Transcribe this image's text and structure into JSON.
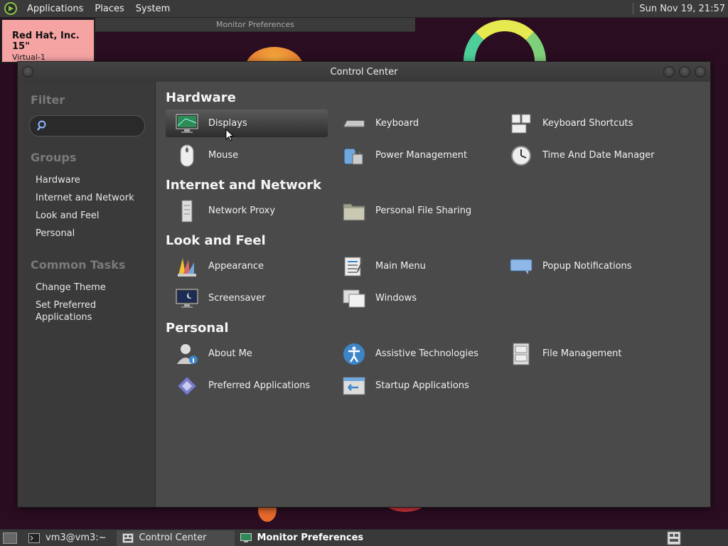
{
  "top_panel": {
    "menus": [
      "Applications",
      "Places",
      "System"
    ],
    "clock": "Sun Nov 19, 21:57"
  },
  "monitor_window": {
    "title": "Monitor Preferences"
  },
  "monitor_label": {
    "name": "Red Hat, Inc. 15\"",
    "output": "Virtual-1"
  },
  "control_center": {
    "title": "Control Center",
    "sidebar": {
      "filter_heading": "Filter",
      "filter_placeholder": "",
      "groups_heading": "Groups",
      "groups": [
        "Hardware",
        "Internet and Network",
        "Look and Feel",
        "Personal"
      ],
      "tasks_heading": "Common Tasks",
      "tasks": [
        "Change Theme",
        "Set Preferred\nApplications"
      ]
    },
    "sections": [
      {
        "title": "Hardware",
        "items": [
          {
            "label": "Displays",
            "icon": "display-icon"
          },
          {
            "label": "Keyboard",
            "icon": "keyboard-icon"
          },
          {
            "label": "Keyboard Shortcuts",
            "icon": "keyboard-shortcuts-icon"
          },
          {
            "label": "Mouse",
            "icon": "mouse-icon"
          },
          {
            "label": "Power Management",
            "icon": "power-icon"
          },
          {
            "label": "Time And Date Manager",
            "icon": "clock-icon"
          }
        ]
      },
      {
        "title": "Internet and Network",
        "items": [
          {
            "label": "Network Proxy",
            "icon": "network-proxy-icon"
          },
          {
            "label": "Personal File Sharing",
            "icon": "folder-share-icon"
          }
        ]
      },
      {
        "title": "Look and Feel",
        "items": [
          {
            "label": "Appearance",
            "icon": "appearance-icon"
          },
          {
            "label": "Main Menu",
            "icon": "main-menu-icon"
          },
          {
            "label": "Popup Notifications",
            "icon": "notification-icon"
          },
          {
            "label": "Screensaver",
            "icon": "screensaver-icon"
          },
          {
            "label": "Windows",
            "icon": "windows-icon"
          }
        ]
      },
      {
        "title": "Personal",
        "items": [
          {
            "label": "About Me",
            "icon": "about-me-icon"
          },
          {
            "label": "Assistive Technologies",
            "icon": "accessibility-icon"
          },
          {
            "label": "File Management",
            "icon": "file-cabinet-icon"
          },
          {
            "label": "Preferred Applications",
            "icon": "preferred-apps-icon"
          },
          {
            "label": "Startup Applications",
            "icon": "startup-icon"
          }
        ]
      }
    ]
  },
  "taskbar": {
    "tasks": [
      {
        "label": "vm3@vm3:~",
        "icon": "terminal-icon"
      },
      {
        "label": "Control Center",
        "icon": "control-center-icon"
      },
      {
        "label": "Monitor Preferences",
        "icon": "display-icon"
      }
    ]
  },
  "colors": {
    "selected_bg": "#2d2d2d",
    "window_bg": "#4a4a4a",
    "label_bg": "#f5a3a3"
  }
}
